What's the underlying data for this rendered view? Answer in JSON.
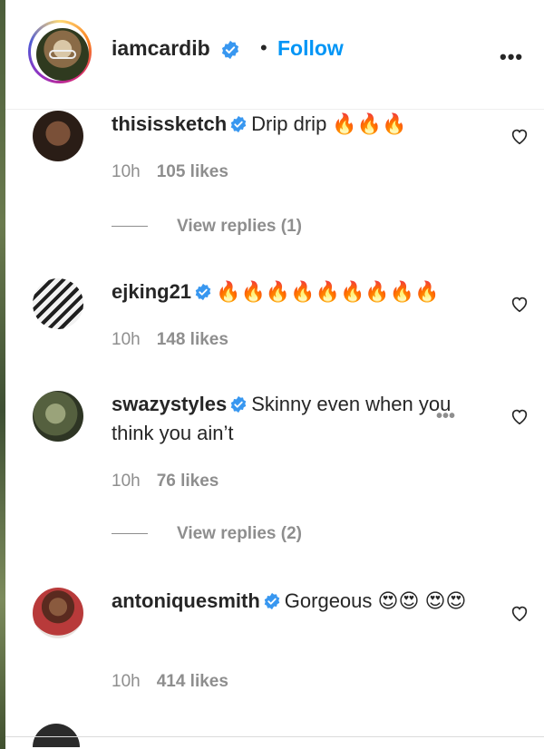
{
  "header": {
    "username": "iamcardib",
    "separator": "•",
    "follow_label": "Follow",
    "more_label": "•••"
  },
  "comments": [
    {
      "username": "thisissketch",
      "verified": true,
      "text": "Drip drip 🔥🔥🔥",
      "time": "10h",
      "likes": "105 likes",
      "replies_label": "View replies (1)"
    },
    {
      "username": "ejking21",
      "verified": true,
      "text": "🔥🔥🔥🔥🔥🔥🔥🔥🔥",
      "time": "10h",
      "likes": "148 likes"
    },
    {
      "username": "swazystyles",
      "verified": true,
      "text": "Skinny even when you think you ain’t",
      "time": "10h",
      "likes": "76 likes",
      "replies_label": "View replies (2)"
    },
    {
      "username": "antoniquesmith",
      "verified": true,
      "text": "Gorgeous 😍😍 😍😍",
      "time": "10h",
      "likes": "414 likes"
    }
  ],
  "ghost_more": "•••",
  "colors": {
    "link_blue": "#0095f6",
    "verified_blue": "#3897f0",
    "muted_gray": "#8e8e8e"
  },
  "icons": {
    "verified": "verified-badge-icon",
    "like": "heart-outline-icon",
    "more": "more-options-icon"
  }
}
